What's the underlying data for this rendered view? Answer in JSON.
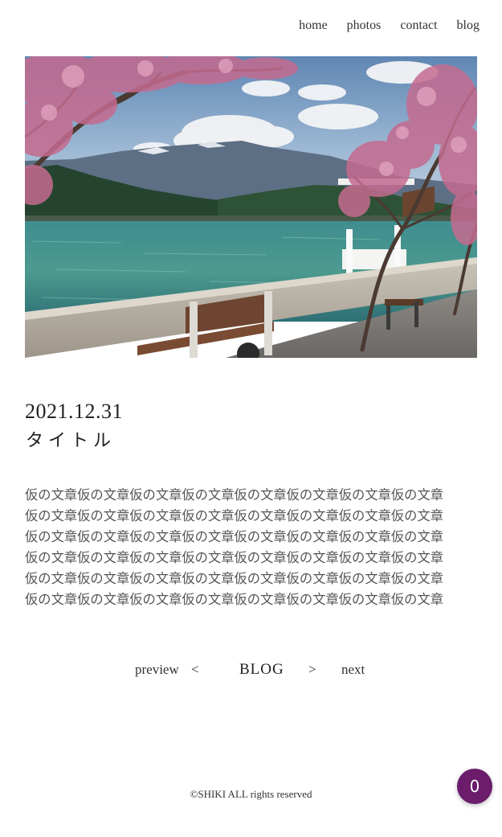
{
  "nav": {
    "items": [
      {
        "label": "home"
      },
      {
        "label": "photos"
      },
      {
        "label": "contact"
      },
      {
        "label": "blog"
      }
    ]
  },
  "post": {
    "date": "2021.12.31",
    "title": "タイトル",
    "body_lines": [
      "仮の文章仮の文章仮の文章仮の文章仮の文章仮の文章仮の文章仮の文章",
      "仮の文章仮の文章仮の文章仮の文章仮の文章仮の文章仮の文章仮の文章",
      "仮の文章仮の文章仮の文章仮の文章仮の文章仮の文章仮の文章仮の文章",
      "仮の文章仮の文章仮の文章仮の文章仮の文章仮の文章仮の文章仮の文章",
      "仮の文章仮の文章仮の文章仮の文章仮の文章仮の文章仮の文章仮の文章",
      "仮の文章仮の文章仮の文章仮の文章仮の文章仮の文章仮の文章仮の文章"
    ]
  },
  "pager": {
    "prev_label": "preview",
    "prev_arrow": "<",
    "blog_label": "BLOG",
    "next_arrow": ">",
    "next_label": "next"
  },
  "footer": {
    "copyright": "©SHIKI ALL rights reserved"
  },
  "badge": {
    "count": "0",
    "color": "#6b1d6b"
  },
  "hero": {
    "icon": "lakeside-cherry-blossom-photo"
  }
}
